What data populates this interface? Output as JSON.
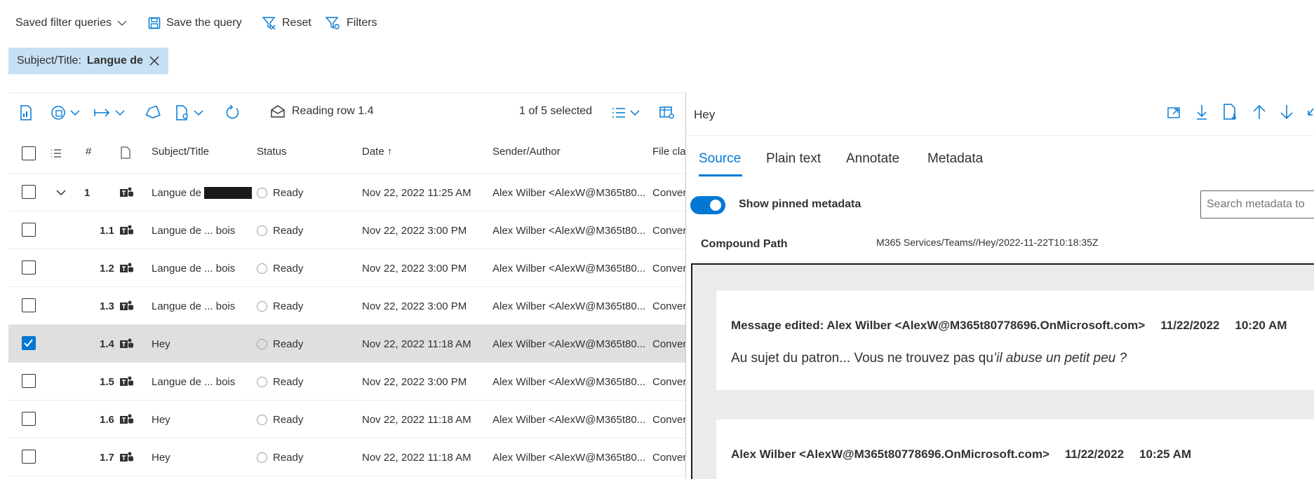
{
  "topbar": {
    "saved_queries": "Saved filter queries",
    "save_query": "Save the query",
    "reset": "Reset",
    "filters": "Filters"
  },
  "filter_chip": {
    "label": "Subject/Title:",
    "value": "Langue de"
  },
  "grid_toolbar": {
    "reading_row": "Reading row 1.4",
    "selection": "1 of 5 selected"
  },
  "grid": {
    "columns": {
      "num": "#",
      "subject": "Subject/Title",
      "status": "Status",
      "date": "Date ↑",
      "sender": "Sender/Author",
      "file": "File cla"
    },
    "rows": [
      {
        "num": "1",
        "subject": "Langue de",
        "status": "Ready",
        "date": "Nov 22, 2022 11:25 AM",
        "sender": "Alex Wilber <AlexW@M365t80...",
        "file": "Conver"
      },
      {
        "num": "1.1",
        "subject": "Langue de ... bois",
        "status": "Ready",
        "date": "Nov 22, 2022 3:00 PM",
        "sender": "Alex Wilber <AlexW@M365t80...",
        "file": "Conver"
      },
      {
        "num": "1.2",
        "subject": "Langue de ... bois",
        "status": "Ready",
        "date": "Nov 22, 2022 3:00 PM",
        "sender": "Alex Wilber <AlexW@M365t80...",
        "file": "Conver"
      },
      {
        "num": "1.3",
        "subject": "Langue de ... bois",
        "status": "Ready",
        "date": "Nov 22, 2022 3:00 PM",
        "sender": "Alex Wilber <AlexW@M365t80...",
        "file": "Conver"
      },
      {
        "num": "1.4",
        "subject": "Hey",
        "status": "Ready",
        "date": "Nov 22, 2022 11:18 AM",
        "sender": "Alex Wilber <AlexW@M365t80...",
        "file": "Conver"
      },
      {
        "num": "1.5",
        "subject": "Langue de ... bois",
        "status": "Ready",
        "date": "Nov 22, 2022 3:00 PM",
        "sender": "Alex Wilber <AlexW@M365t80...",
        "file": "Conver"
      },
      {
        "num": "1.6",
        "subject": "Hey",
        "status": "Ready",
        "date": "Nov 22, 2022 11:18 AM",
        "sender": "Alex Wilber <AlexW@M365t80...",
        "file": "Conver"
      },
      {
        "num": "1.7",
        "subject": "Hey",
        "status": "Ready",
        "date": "Nov 22, 2022 11:18 AM",
        "sender": "Alex Wilber <AlexW@M365t80...",
        "file": "Conver"
      }
    ]
  },
  "viewer": {
    "title": "Hey",
    "tabs": {
      "source": "Source",
      "plain": "Plain text",
      "annotate": "Annotate",
      "metadata": "Metadata"
    },
    "toggle_label": "Show pinned metadata",
    "search_placeholder": "Search metadata to",
    "compound_label": "Compound Path",
    "compound_value": "M365 Services/Teams//Hey/2022-11-22T10:18:35Z",
    "messages": [
      {
        "header": "Message edited: Alex Wilber <AlexW@M365t80778696.OnMicrosoft.com>",
        "date": "11/22/2022",
        "time": "10:20 AM",
        "body": "Au sujet du patron... Vous ne trouvez pas qu",
        "body_italic": "’il abuse un petit peu ?"
      },
      {
        "header": "Alex Wilber <AlexW@M365t80778696.OnMicrosoft.com>",
        "date": "11/22/2022",
        "time": "10:25 AM"
      }
    ]
  },
  "colors": {
    "accent": "#0078d4",
    "chip_bg": "#c7e0f4",
    "selected_row": "#e1dfdd",
    "doc_bg": "#ebebeb"
  }
}
